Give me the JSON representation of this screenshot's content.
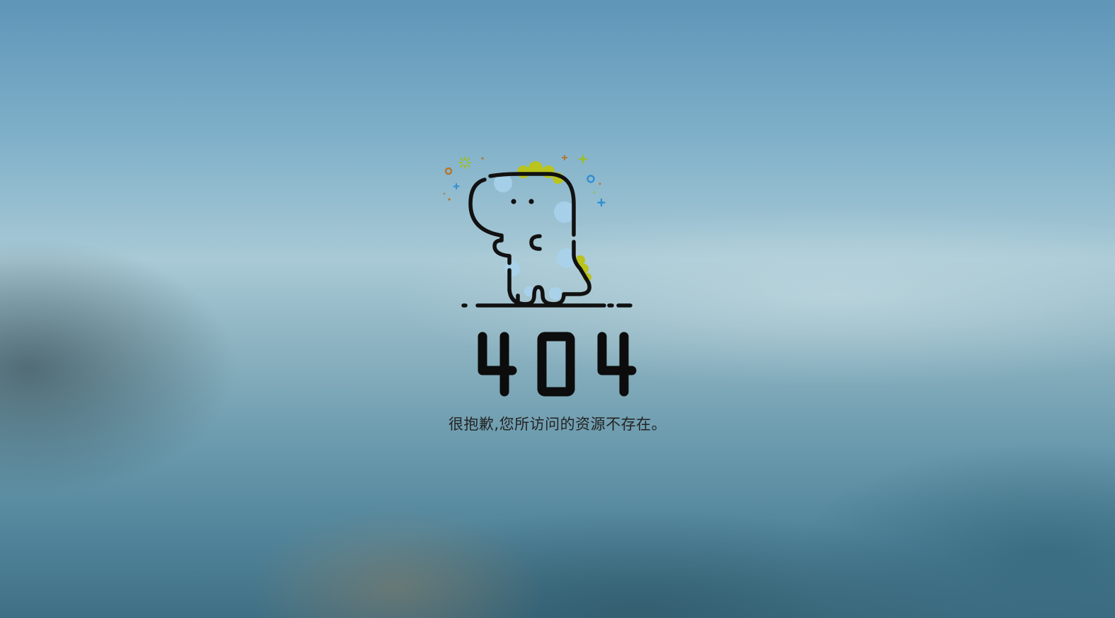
{
  "error": {
    "code": "404",
    "message": "很抱歉,您所访问的资源不存在。"
  },
  "illustration": {
    "icon": "dinosaur-icon",
    "colors": {
      "outline": "#111111",
      "spots": "#a9d3ee",
      "spikes": "#b9c41c",
      "sparkle_orange": "#b5762e",
      "sparkle_blue": "#2f8fd4",
      "sparkle_green": "#9bbf2a"
    }
  }
}
